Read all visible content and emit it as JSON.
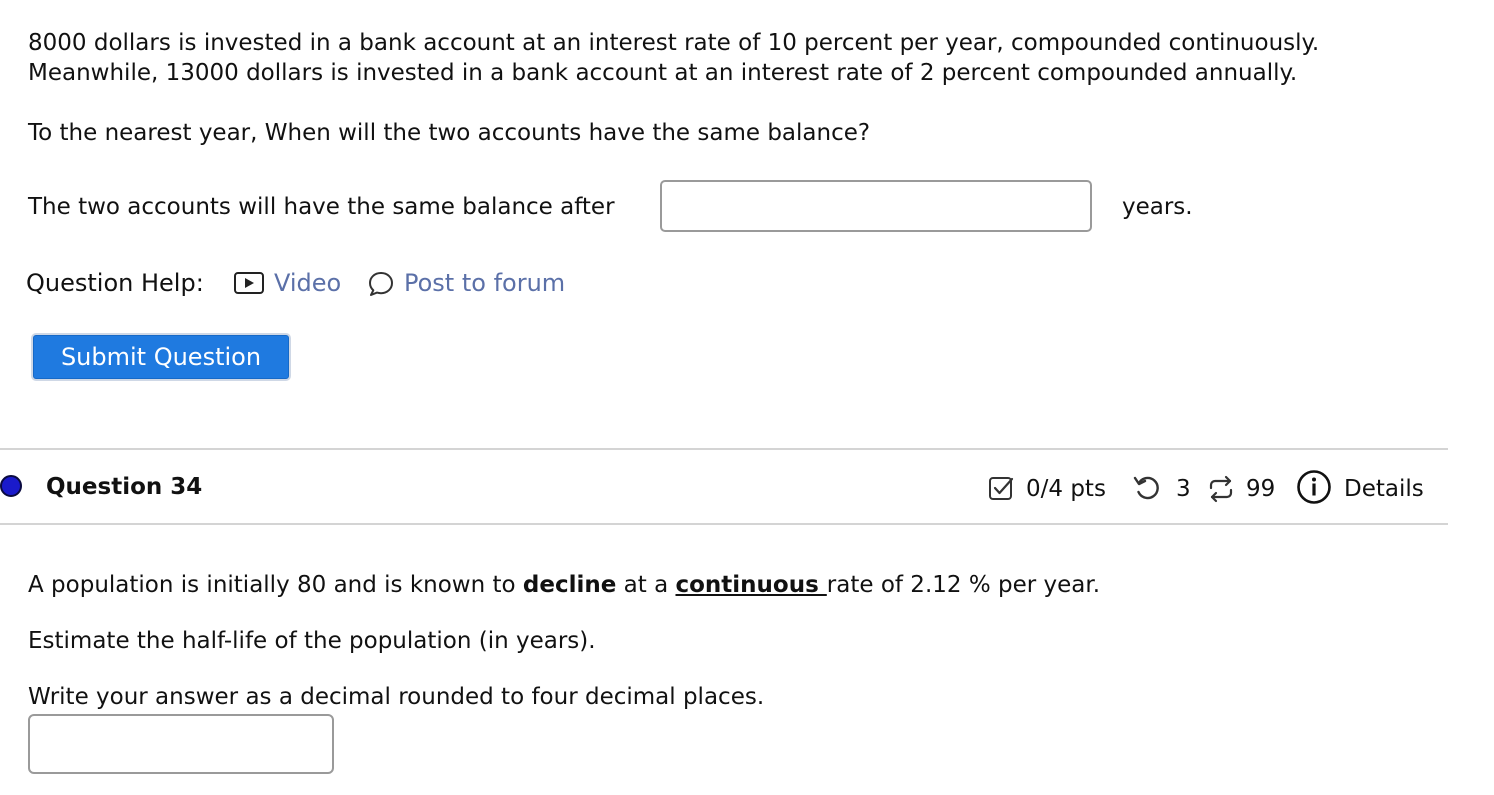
{
  "prev_question": {
    "problem_line1": "8000 dollars is invested in a bank account at an interest rate of 10 percent per year, compounded continuously.",
    "problem_line2": "Meanwhile, 13000 dollars is invested in a bank account at an interest rate of 2 percent compounded annually.",
    "prompt": "To the nearest year, When will the two accounts have the same balance?",
    "answer_label": "The two accounts will have the same balance after",
    "answer_value": "",
    "answer_unit": "years.",
    "help": {
      "label": "Question Help:",
      "video_label": "Video",
      "video_icon": "video-play-icon",
      "forum_label": "Post to forum",
      "forum_icon": "speech-bubble-icon"
    },
    "submit_label": "Submit Question"
  },
  "question_34": {
    "title": "Question 34",
    "status_dot_color": "#1a1acb",
    "points": "0/4 pts",
    "points_icon": "checkbox-icon",
    "retries": "3",
    "retries_icon": "retry-icon",
    "attempts": "99",
    "attempts_icon": "attempts-icon",
    "details_label": "Details",
    "details_icon": "info-icon",
    "body": {
      "p1_before": "A population is initially 80 and is known to ",
      "p1_bold": "decline",
      "p1_mid": " at a ",
      "p1_underline": "continuous ",
      "p1_after": "rate of 2.12 % per year.",
      "p2": "Estimate the half-life of the population (in years).",
      "p3": "Write your answer as a decimal rounded to four decimal places."
    },
    "answer_value": ""
  },
  "colors": {
    "link": "#5b70a8",
    "button": "#1f7ae0",
    "divider": "#d4d4d4"
  }
}
